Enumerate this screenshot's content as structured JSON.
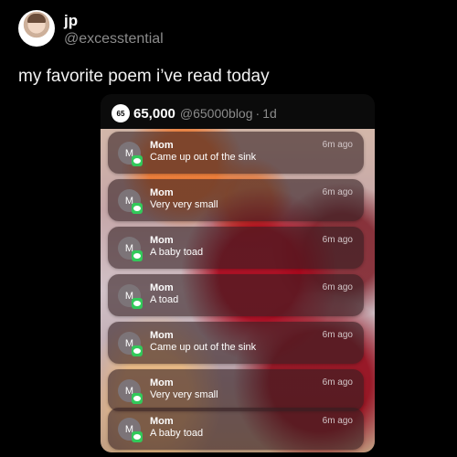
{
  "post": {
    "author_name": "jp",
    "author_handle": "@excesstential",
    "text": "my favorite poem i’ve read today"
  },
  "quoted": {
    "logo_text": "65",
    "name": "65,000",
    "handle": "@65000blog",
    "separator": "·",
    "age": "1d"
  },
  "notifications": [
    {
      "initial": "M",
      "sender": "Mom",
      "message": "Came up out of the sink",
      "time": "6m ago"
    },
    {
      "initial": "M",
      "sender": "Mom",
      "message": "Very very small",
      "time": "6m ago"
    },
    {
      "initial": "M",
      "sender": "Mom",
      "message": "A baby toad",
      "time": "6m ago"
    },
    {
      "initial": "M",
      "sender": "Mom",
      "message": "A toad",
      "time": "6m ago"
    },
    {
      "initial": "M",
      "sender": "Mom",
      "message": "Came up out of the sink",
      "time": "6m ago"
    },
    {
      "initial": "M",
      "sender": "Mom",
      "message": "Very very small",
      "time": "6m ago"
    },
    {
      "initial": "M",
      "sender": "Mom",
      "message": "A baby toad",
      "time": "6m ago"
    }
  ],
  "colors": {
    "background": "#000000",
    "badge": "#32c95a",
    "muted": "#8b8b8b"
  },
  "icons": {
    "message_badge": "messages-icon"
  }
}
